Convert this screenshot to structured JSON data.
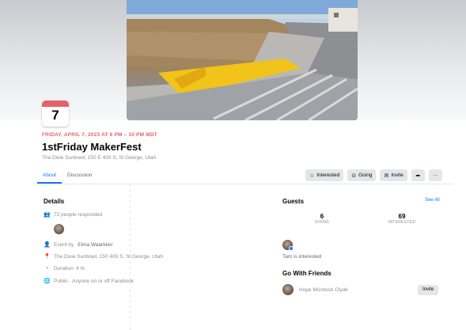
{
  "colors": {
    "accent": "#1877f2",
    "date_red": "#e4606d",
    "button_bg": "#e4e6eb"
  },
  "event": {
    "day": "7",
    "when": "FRIDAY, APRIL 7, 2023 AT 6 PM – 10 PM MDT",
    "title": "1stFriday MakerFest",
    "location": "The Dixie Sunbowl, 150 E 400 S, St George, Utah"
  },
  "tabs": [
    {
      "label": "About"
    },
    {
      "label": "Discussion"
    }
  ],
  "actions": {
    "interested": "Interested",
    "going": "Going",
    "invite": "Invite",
    "more": "···",
    "share_icon": "share-arrow-icon"
  },
  "details": {
    "title": "Details",
    "responded": "72 people responded",
    "host_prefix": "Event by",
    "host_name": "Elma Waarkker",
    "location": "The Dixie Sunbowl, 150 400 S, St George, Utah",
    "duration": "Duration: 4 hr",
    "privacy": "Public · Anyone on or off Facebook"
  },
  "guests": {
    "title": "Guests",
    "see_all": "See All",
    "going_count": "6",
    "going_label": "GOING",
    "interested_count": "69",
    "interested_label": "INTERESTED",
    "guest_line": "Tam is interested"
  },
  "friends": {
    "title": "Go With Friends",
    "friend_name": "Hope Mcintosh Clyde",
    "invite": "Invite"
  }
}
